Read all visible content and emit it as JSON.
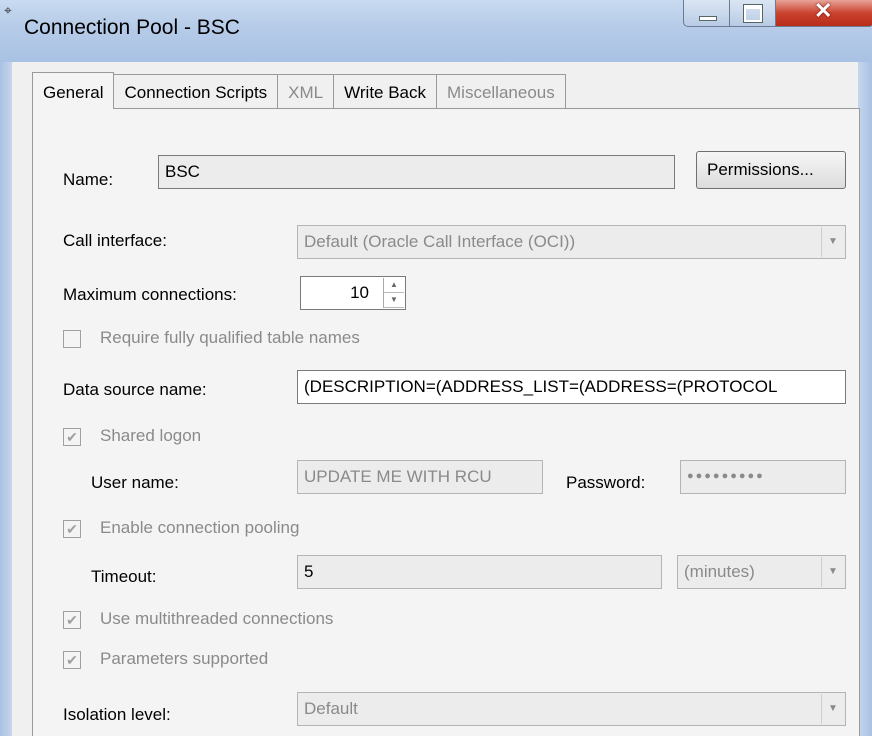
{
  "window": {
    "title": "Connection Pool - BSC"
  },
  "tabs": [
    {
      "label": "General",
      "state": "active"
    },
    {
      "label": "Connection Scripts",
      "state": "enabled"
    },
    {
      "label": "XML",
      "state": "disabled"
    },
    {
      "label": "Write Back",
      "state": "enabled"
    },
    {
      "label": "Miscellaneous",
      "state": "disabled"
    }
  ],
  "general": {
    "name_label": "Name:",
    "name_value": "BSC",
    "permissions_button": "Permissions...",
    "call_interface_label": "Call interface:",
    "call_interface_value": "Default (Oracle Call Interface (OCI))",
    "max_connections_label": "Maximum connections:",
    "max_connections_value": "10",
    "require_fq_label": "Require fully qualified table names",
    "data_source_label": "Data source name:",
    "data_source_value": "(DESCRIPTION=(ADDRESS_LIST=(ADDRESS=(PROTOCOL",
    "shared_logon_label": "Shared logon",
    "shared_logon_checked": "✔",
    "user_name_label": "User name:",
    "user_name_value": "UPDATE ME WITH RCU",
    "password_label": "Password:",
    "password_value": "●●●●●●●●●",
    "enable_pooling_label": "Enable connection pooling",
    "enable_pooling_checked": "✔",
    "timeout_label": "Timeout:",
    "timeout_value": "5",
    "timeout_unit": "(minutes)",
    "multithreaded_label": "Use multithreaded connections",
    "multithreaded_checked": "✔",
    "parameters_label": "Parameters supported",
    "parameters_checked": "✔",
    "isolation_label": "Isolation level:",
    "isolation_value": "Default"
  },
  "colors": {
    "titlebar": "#b5cbe8",
    "close_button": "#c9432f",
    "panel": "#f4f4f4",
    "disabled_text": "#8a8a8a"
  }
}
